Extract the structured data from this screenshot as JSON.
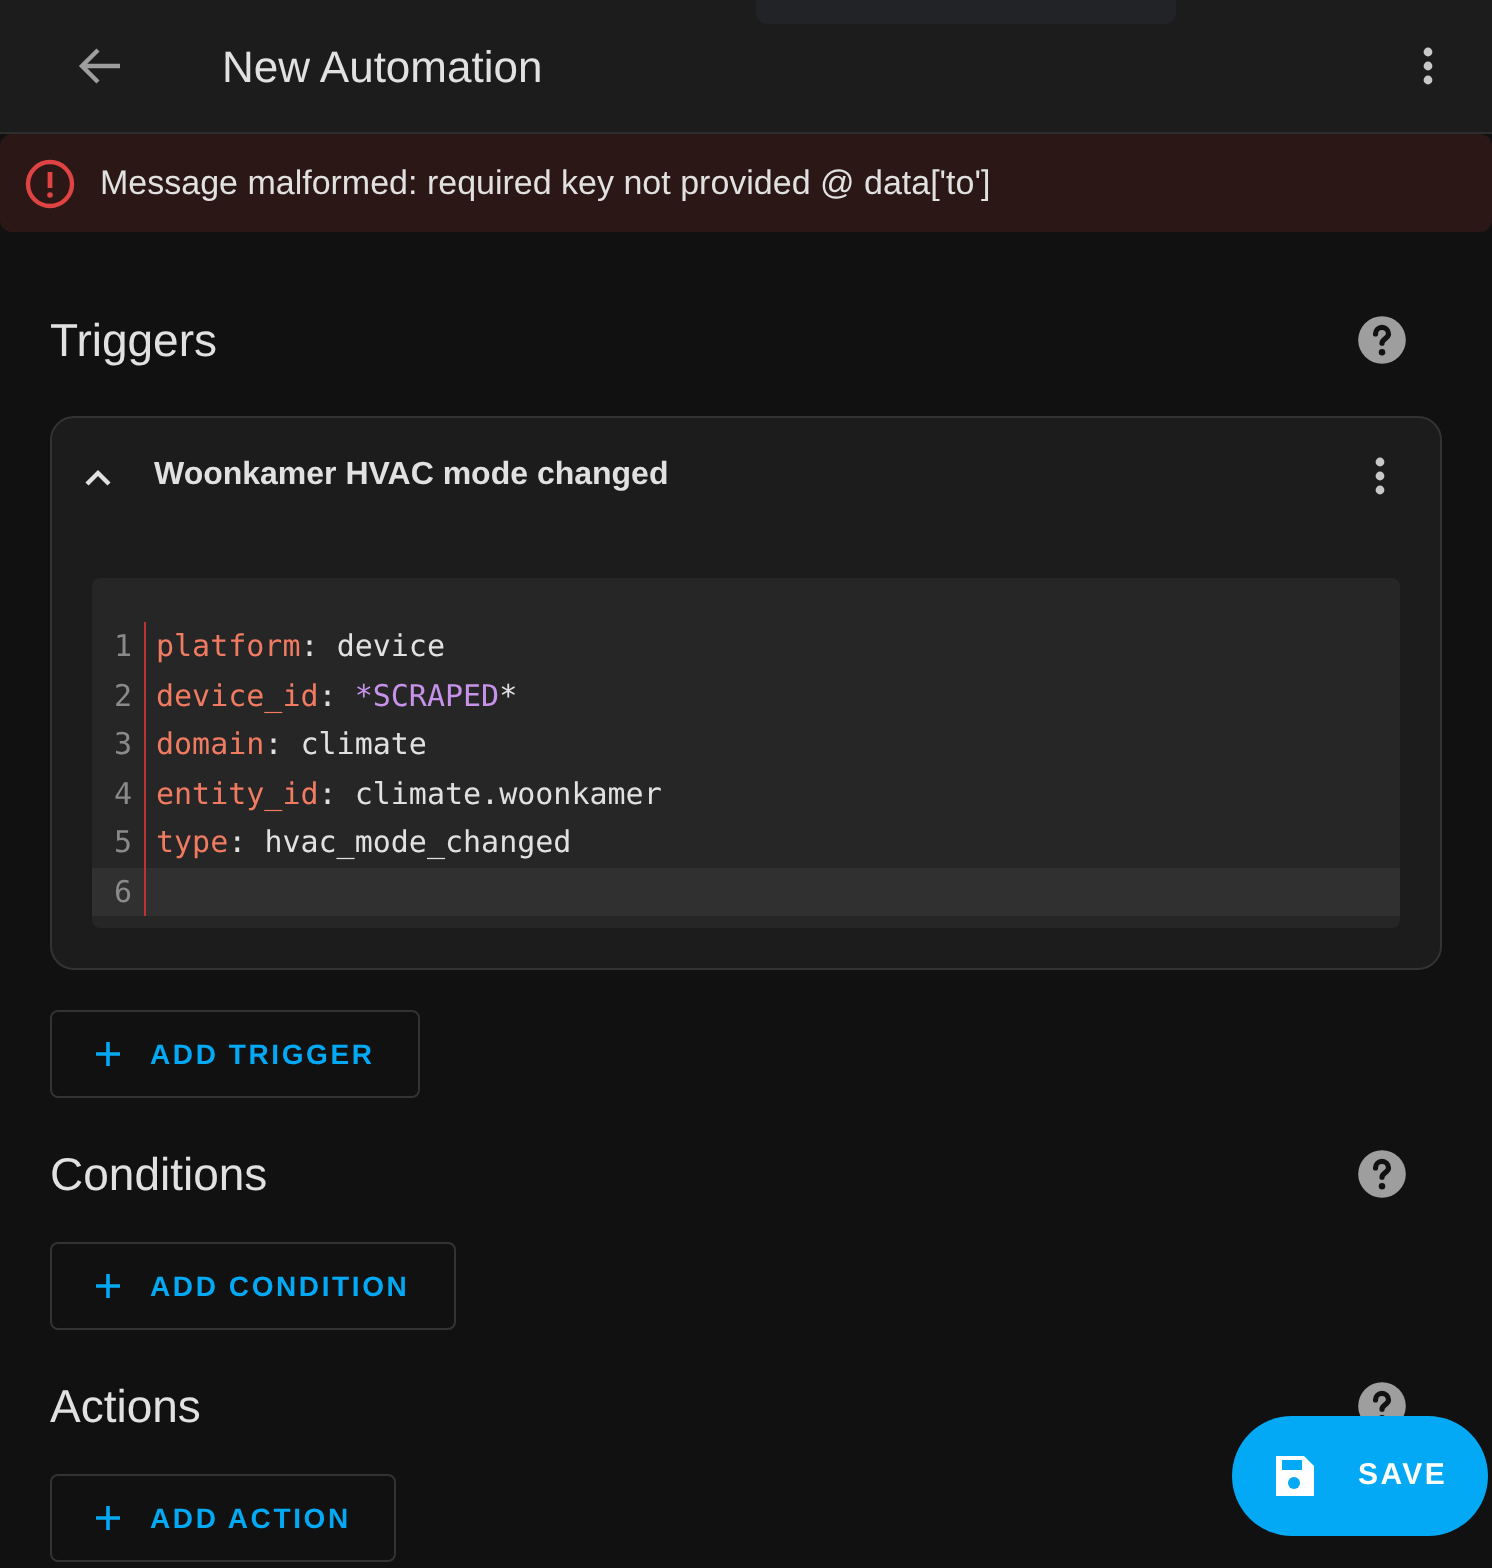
{
  "header": {
    "title": "New Automation"
  },
  "error": {
    "message": "Message malformed: required key not provided @ data['to']"
  },
  "sections": [
    {
      "title": "Triggers",
      "card": {
        "title": "Woonkamer HVAC mode changed",
        "expanded": true,
        "code": [
          {
            "number": "1",
            "selected": false,
            "tokens": [
              {
                "text": "platform",
                "kind": "key"
              },
              {
                "text": ": ",
                "kind": "punct"
              },
              {
                "text": "device",
                "kind": "plain"
              }
            ]
          },
          {
            "number": "2",
            "selected": false,
            "tokens": [
              {
                "text": "device_id",
                "kind": "key"
              },
              {
                "text": ": ",
                "kind": "punct"
              },
              {
                "text": "*SCRAPED",
                "kind": "alias"
              },
              {
                "text": "*",
                "kind": "plain"
              }
            ]
          },
          {
            "number": "3",
            "selected": false,
            "tokens": [
              {
                "text": "domain",
                "kind": "key"
              },
              {
                "text": ": ",
                "kind": "punct"
              },
              {
                "text": "climate",
                "kind": "plain"
              }
            ]
          },
          {
            "number": "4",
            "selected": false,
            "tokens": [
              {
                "text": "entity_id",
                "kind": "key"
              },
              {
                "text": ": ",
                "kind": "punct"
              },
              {
                "text": "climate.woonkamer",
                "kind": "plain"
              }
            ]
          },
          {
            "number": "5",
            "selected": false,
            "tokens": [
              {
                "text": "type",
                "kind": "key"
              },
              {
                "text": ": ",
                "kind": "punct"
              },
              {
                "text": "hvac_mode_changed",
                "kind": "plain"
              }
            ]
          },
          {
            "number": "6",
            "selected": true
          }
        ]
      },
      "button": "ADD TRIGGER"
    },
    {
      "title": "Conditions",
      "button": "ADD CONDITION"
    },
    {
      "title": "Actions",
      "button": "ADD ACTION"
    }
  ],
  "save_button": {
    "label": "SAVE"
  }
}
